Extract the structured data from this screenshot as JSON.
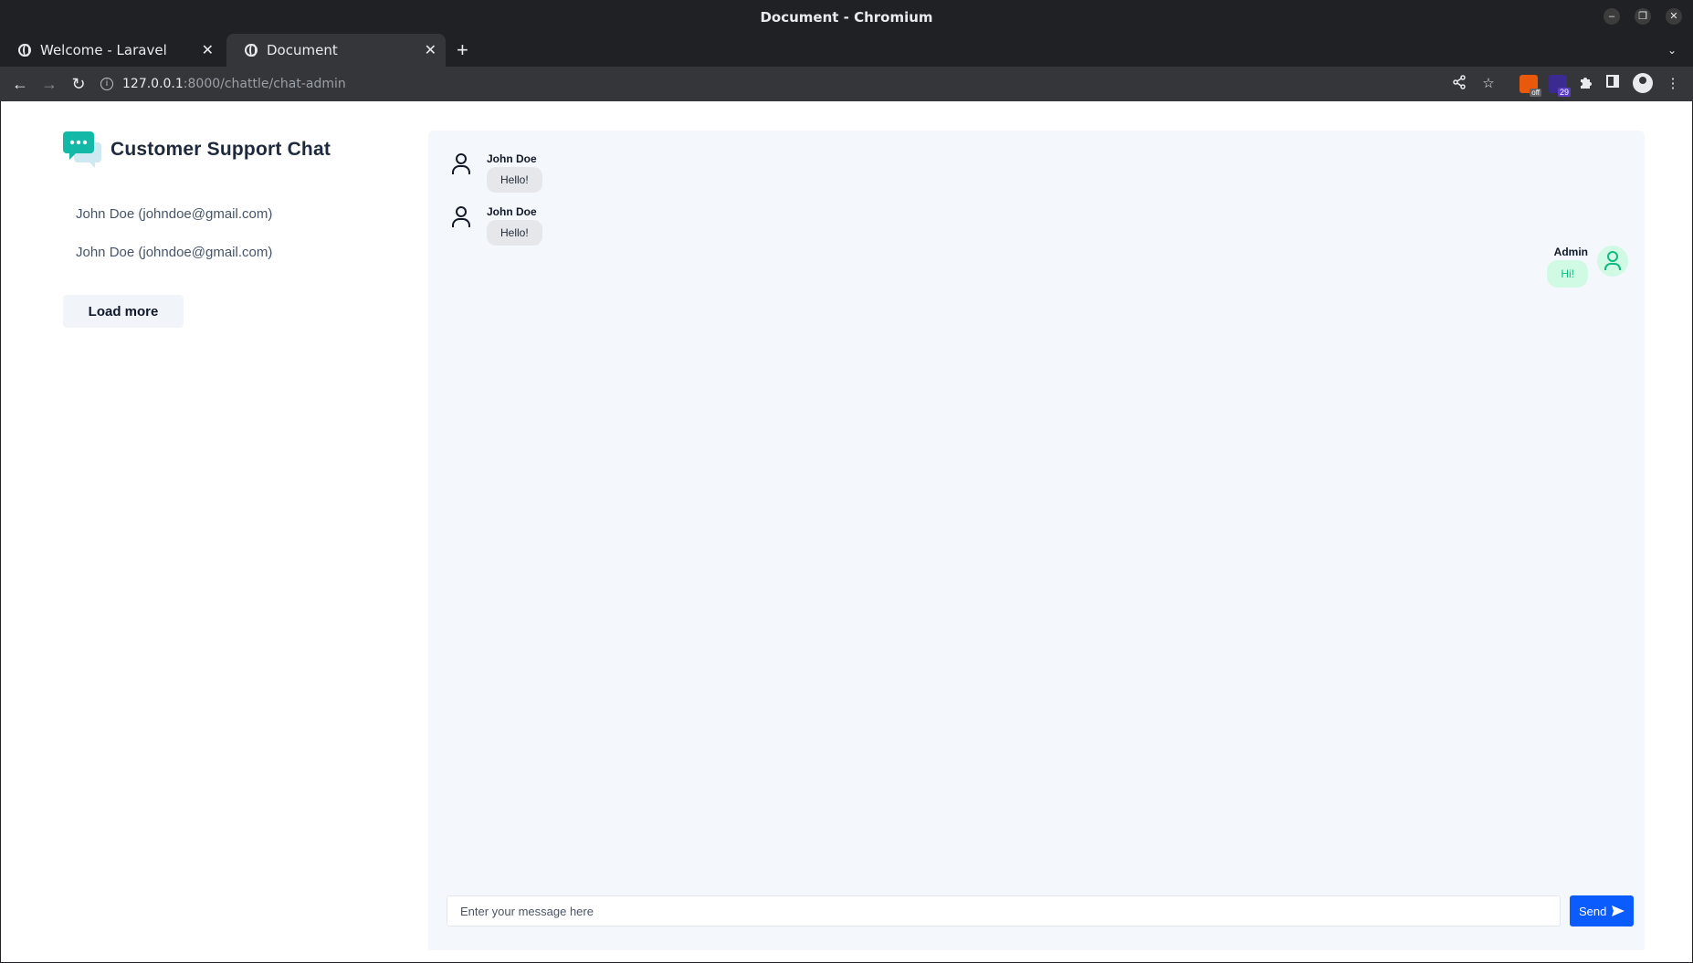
{
  "window": {
    "title": "Document - Chromium",
    "controls": {
      "minimize": "–",
      "restore": "❐",
      "close": "✕"
    }
  },
  "tabs": [
    {
      "label": "Welcome - Laravel",
      "close": "✕"
    },
    {
      "label": "Document",
      "close": "✕"
    }
  ],
  "new_tab": "+",
  "tab_menu": "⌄",
  "toolbar": {
    "back": "←",
    "forward": "→",
    "reload": "↻",
    "url_host": "127.0.0.1",
    "url_path": ":8000/chattle/chat-admin",
    "info_icon": "i",
    "share_icon": "share-icon",
    "bookmark_icon": "☆",
    "extensions_icon": "puzzle-icon",
    "menu": "⋮",
    "ext_badge_1": "off",
    "ext_badge_2": "29"
  },
  "sidebar": {
    "brand_title": "Customer Support Chat",
    "users": [
      {
        "label": "John Doe (johndoe@gmail.com)"
      },
      {
        "label": "John Doe (johndoe@gmail.com)"
      }
    ],
    "load_more": "Load more"
  },
  "chat": {
    "messages": [
      {
        "sender": "John Doe",
        "text": "Hello!",
        "side": "left"
      },
      {
        "sender": "John Doe",
        "text": "Hello!",
        "side": "left"
      },
      {
        "sender": "Admin",
        "text": "Hi!",
        "side": "right"
      }
    ],
    "input_placeholder": "Enter your message here",
    "send_label": "Send"
  },
  "colors": {
    "brand_teal": "#14b8a6",
    "send_blue": "#0b5cff",
    "admin_green": "#10b981"
  }
}
